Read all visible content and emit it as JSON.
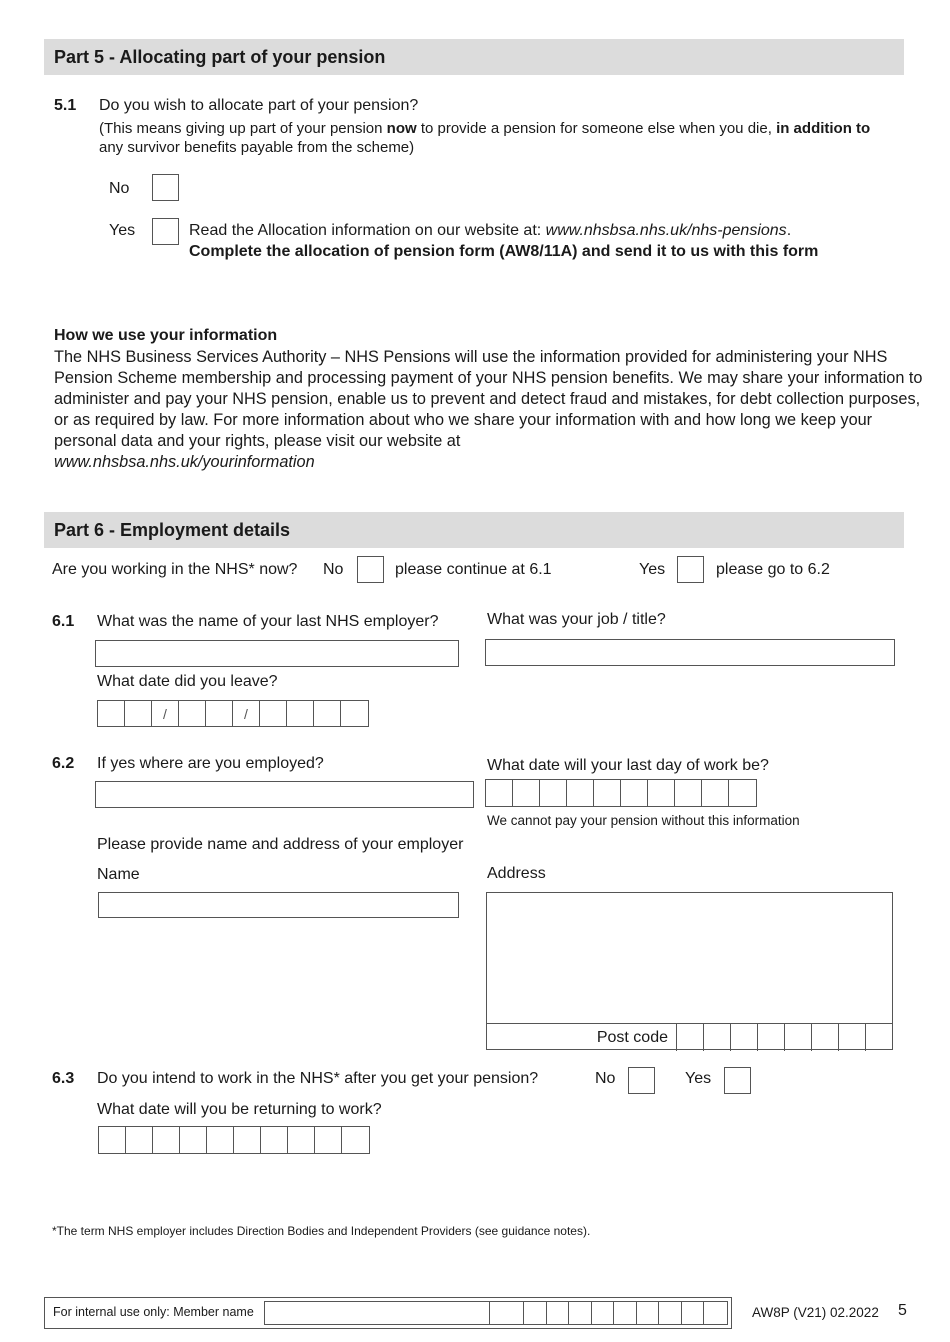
{
  "part5": {
    "title": "Part 5 - Allocating part of your pension",
    "q51": {
      "number": "5.1",
      "question": "Do you wish to allocate part of your pension?",
      "note_pre": "(This means giving up part of your pension ",
      "note_bold1": "now",
      "note_mid": " to provide a pension for someone else when you die, ",
      "note_bold2": "in addition to",
      "note_post": " any survivor benefits payable from the scheme)",
      "no_label": "No",
      "yes_label": "Yes",
      "yes_info_pre": "Read the Allocation information on our website at: ",
      "yes_info_link": "www.nhsbsa.nhs.uk/nhs-pensions",
      "yes_info_post": ".",
      "yes_instruction": "Complete the allocation of pension form (AW8/11A) and send it to us with this form"
    }
  },
  "info": {
    "heading": "How we use your information",
    "body": "The NHS Business Services Authority – NHS Pensions will use the information provided for administering your NHS Pension Scheme membership and processing payment of your NHS pension benefits. We may share your information to administer and pay your NHS pension, enable us to prevent and detect fraud and mistakes, for debt collection purposes, or as required by law. For more information about who we share your information with and how long we keep your personal data and your rights, please visit our website at",
    "link": "www.nhsbsa.nhs.uk/yourinformation"
  },
  "part6": {
    "title": "Part 6 - Employment details",
    "working_q": "Are you working in the NHS* now?",
    "no_label": "No",
    "no_hint": "please continue at 6.1",
    "yes_label": "Yes",
    "yes_hint": "please go to 6.2",
    "q61": {
      "number": "6.1",
      "employer_label": "What was the name of your last NHS employer?",
      "job_label": "What was your job / title?",
      "leave_label": "What date did you leave?",
      "date_cells": [
        "",
        "",
        "/",
        "",
        "",
        "/",
        "",
        "",
        "",
        ""
      ]
    },
    "q62": {
      "number": "6.2",
      "employed_label": "If yes where are you employed?",
      "last_day_label": "What date will your last day of work be?",
      "last_day_note": "We cannot pay your pension without this information",
      "date_cells": [
        "",
        "",
        "",
        "",
        "",
        "",
        "",
        "",
        "",
        ""
      ],
      "provide_label": "Please provide name and address of your employer",
      "name_label": "Name",
      "address_label": "Address",
      "postcode_label": "Post code",
      "postcode_cells": [
        "",
        "",
        "",
        "",
        "",
        "",
        "",
        ""
      ]
    },
    "q63": {
      "number": "6.3",
      "question": "Do you intend to work in the NHS* after you get your pension?",
      "no_label": "No",
      "yes_label": "Yes",
      "return_label": "What date will you be returning to work?",
      "date_cells": [
        "",
        "",
        "",
        "",
        "",
        "",
        "",
        "",
        "",
        ""
      ]
    },
    "footnote": "*The term NHS employer includes Direction Bodies and Independent Providers (see guidance notes)."
  },
  "footer": {
    "internal_label": "For internal use only: Member name",
    "ref_cells": [
      "",
      "",
      "",
      "",
      "",
      "",
      "",
      "",
      "",
      ""
    ],
    "form_code": "AW8P (V21) 02.2022",
    "page_number": "5"
  }
}
